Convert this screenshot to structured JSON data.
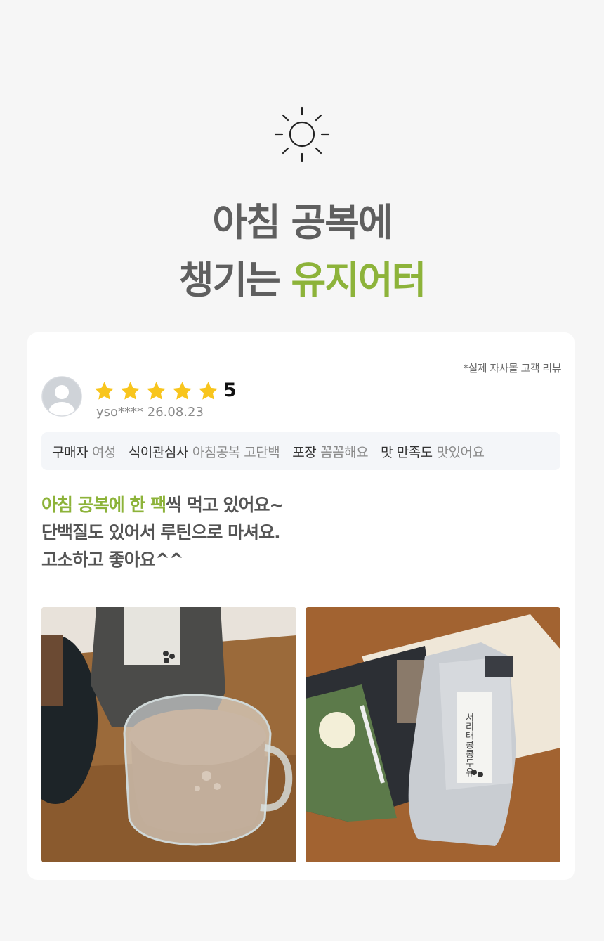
{
  "hero": {
    "icon": "sun-icon",
    "line1": "아침 공복에",
    "line2_plain": "챙기는 ",
    "line2_highlight": "유지어터",
    "accent_color": "#8db33a"
  },
  "review": {
    "source_note": "*실제 자사몰 고객 리뷰",
    "avatar_icon": "user-avatar-icon",
    "stars": 5,
    "rating": "5",
    "user_and_date": "yso**** 26.08.23",
    "tags": [
      {
        "key": "구매자",
        "value": "여성"
      },
      {
        "key": "식이관심사",
        "value": "아침공복 고단백"
      },
      {
        "key": "포장",
        "value": "꼼꼼해요"
      },
      {
        "key": "맛 만족도",
        "value": "맛있어요"
      }
    ],
    "text": {
      "line1_highlight": "아침 공복에 한 팩",
      "line1_rest": "씩 먹고 있어요~",
      "line2": "단백질도 있어서 루틴으로 마셔요.",
      "line3": "고소하고 좋아요^^"
    },
    "photos": [
      "photo-soymilk-in-glass-cup",
      "photo-product-pouch-and-leaflet"
    ],
    "photo2_pouch_text": "서리태콩콩두유"
  }
}
